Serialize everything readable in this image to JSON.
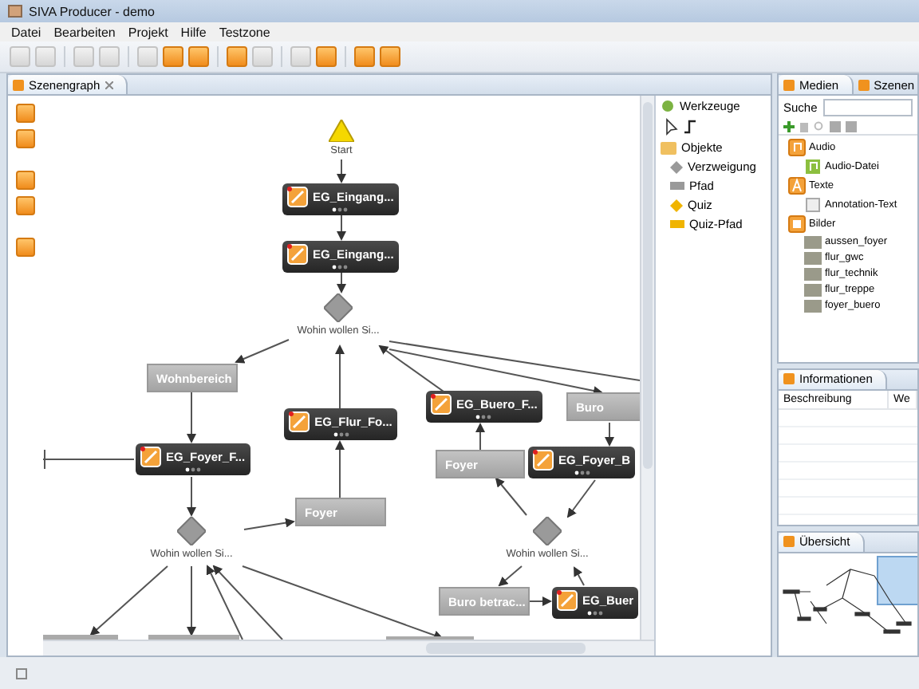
{
  "window": {
    "title": "SIVA Producer - demo"
  },
  "menu": [
    "Datei",
    "Bearbeiten",
    "Projekt",
    "Hilfe",
    "Testzone"
  ],
  "toolbar": [
    {
      "disabled": true
    },
    {
      "disabled": true
    },
    {
      "disabled": true
    },
    {
      "disabled": true
    },
    {
      "disabled": true
    },
    {
      "disabled": false
    },
    {
      "disabled": false
    },
    {
      "disabled": false
    },
    {
      "disabled": true
    },
    {
      "disabled": true
    },
    {
      "disabled": false
    },
    {
      "disabled": false
    },
    {
      "disabled": false
    }
  ],
  "editor": {
    "tab": {
      "label": "Szenengraph",
      "selected": true
    },
    "nodes": [
      {
        "kind": "start",
        "label": "Start"
      },
      {
        "kind": "scene",
        "label": "EG_Eingang..."
      },
      {
        "kind": "scene",
        "label": "EG_Eingang..."
      },
      {
        "kind": "decision",
        "label": "Wohin wollen Si..."
      },
      {
        "kind": "path",
        "label": "Wohnbereich"
      },
      {
        "kind": "scene",
        "label": "EG_Foyer_F..."
      },
      {
        "kind": "scene",
        "label": "EG_Flur_Fo..."
      },
      {
        "kind": "scene",
        "label": "EG_Buero_F..."
      },
      {
        "kind": "path",
        "label": "Buro"
      },
      {
        "kind": "path",
        "label": "Foyer"
      },
      {
        "kind": "scene",
        "label": "EG_Foyer_B"
      },
      {
        "kind": "path",
        "label": "Foyer"
      },
      {
        "kind": "decision",
        "label": "Wohin wollen Si..."
      },
      {
        "kind": "decision",
        "label": "Wohin wollen Si..."
      },
      {
        "kind": "path",
        "label": "Buro betrac..."
      },
      {
        "kind": "scene",
        "label": "EG_Buer"
      }
    ]
  },
  "palette": {
    "title": "Werkzeuge",
    "group": "Objekte",
    "items": [
      {
        "label": "Verzweigung",
        "kind": "branch"
      },
      {
        "label": "Pfad",
        "kind": "path"
      },
      {
        "label": "Quiz",
        "kind": "quiz"
      },
      {
        "label": "Quiz-Pfad",
        "kind": "quiz-path"
      }
    ]
  },
  "media": {
    "tabs": [
      {
        "label": "Medien",
        "selected": true
      },
      {
        "label": "Szenen",
        "selected": false
      }
    ],
    "search_label": "Suche",
    "tree": [
      {
        "label": "Audio",
        "kind": "audio",
        "children": [
          {
            "label": "Audio-Datei",
            "kind": "audio-file"
          }
        ]
      },
      {
        "label": "Texte",
        "kind": "text",
        "children": [
          {
            "label": "Annotation-Text",
            "kind": "text-file"
          }
        ]
      },
      {
        "label": "Bilder",
        "kind": "images",
        "children": [
          {
            "label": "aussen_foyer",
            "kind": "image"
          },
          {
            "label": "flur_gwc",
            "kind": "image"
          },
          {
            "label": "flur_technik",
            "kind": "image"
          },
          {
            "label": "flur_treppe",
            "kind": "image"
          },
          {
            "label": "foyer_buero",
            "kind": "image"
          }
        ]
      }
    ]
  },
  "info": {
    "title": "Informationen",
    "columns": [
      "Beschreibung",
      "We"
    ]
  },
  "overview": {
    "title": "Übersicht"
  }
}
